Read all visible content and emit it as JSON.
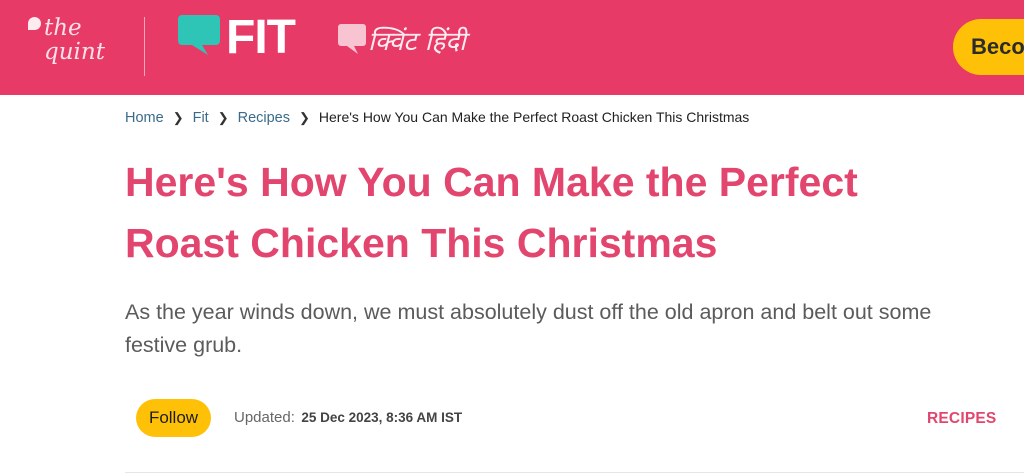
{
  "header": {
    "logo_quint": [
      "the",
      "quint"
    ],
    "logo_fit": "FIT",
    "logo_hindi": "क्विंट हिंदी",
    "become_button": "Beco"
  },
  "breadcrumb": {
    "items": [
      "Home",
      "Fit",
      "Recipes"
    ],
    "current": "Here's How You Can Make the Perfect Roast Chicken This Christmas"
  },
  "article": {
    "headline": "Here's How You Can Make the Perfect Roast Chicken This Christmas",
    "deck": "As the year winds down, we must absolutely dust off the old apron and belt out some festive grub.",
    "follow_label": "Follow",
    "updated_label": "Updated:",
    "updated_value": "25 Dec 2023, 8:36 AM IST",
    "category": "RECIPES"
  },
  "colors": {
    "brand_pink": "#e73a67",
    "headline_pink": "#e2456d",
    "accent_yellow": "#ffc107",
    "fit_teal": "#2ec4b6"
  }
}
